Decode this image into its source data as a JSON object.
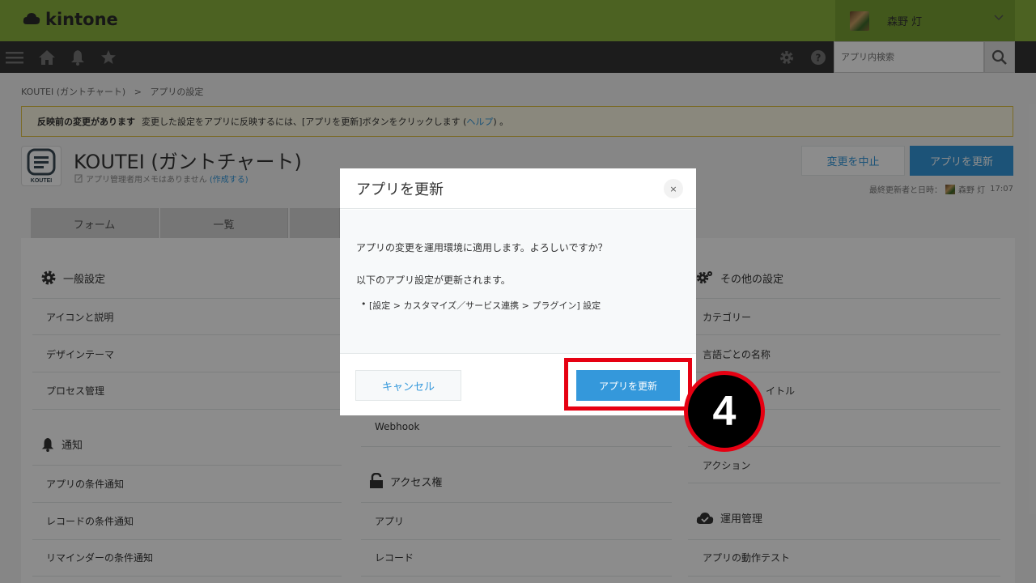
{
  "header": {
    "logo_text": "kintone",
    "user_name": "森野 灯",
    "brand_color": "#8ab33f"
  },
  "navbar": {
    "search_placeholder": "アプリ内検索",
    "icons": [
      "menu-icon",
      "home-icon",
      "bell-icon",
      "star-icon",
      "gear-icon",
      "help-icon",
      "search-icon"
    ]
  },
  "breadcrumb": {
    "app": "KOUTEI (ガントチャート)",
    "separator": ">",
    "current": "アプリの設定"
  },
  "banner": {
    "title": "反映前の変更があります",
    "text": "変更した設定をアプリに反映するには、[アプリを更新]ボタンをクリックします (",
    "link": "ヘルプ",
    "tail": ") 。"
  },
  "app": {
    "icon_label": "KOUTEI",
    "title": "KOUTEI (ガントチャート)",
    "memo": "アプリ管理者用メモはありません",
    "memo_link": "(作成する)",
    "cancel_change_label": "変更を中止",
    "update_label": "アプリを更新",
    "last_updated_label": "最終更新者と日時：",
    "last_updated_user": "森野 灯",
    "last_updated_time": "17:07"
  },
  "tabs": [
    "フォーム",
    "一覧"
  ],
  "settings": {
    "general": {
      "title": "一般設定",
      "items": [
        "アイコンと説明",
        "デザインテーマ",
        "プロセス管理"
      ]
    },
    "notify": {
      "title": "通知",
      "items": [
        "アプリの条件通知",
        "レコードの条件通知",
        "リマインダーの条件通知"
      ]
    },
    "middle": {
      "webhook": "Webhook",
      "access_title": "アクセス権",
      "access_items": [
        "アプリ",
        "レコード"
      ]
    },
    "other": {
      "title": "その他の設定",
      "items": [
        "カテゴリー",
        "言語ごとの名称"
      ],
      "partial_item": "イトル",
      "action": "アクション"
    },
    "ops": {
      "title": "運用管理",
      "items": [
        "アプリの動作テスト"
      ]
    }
  },
  "modal": {
    "title": "アプリを更新",
    "close": "×",
    "message": "アプリの変更を運用環境に適用します。よろしいですか？",
    "sub": "以下のアプリ設定が更新されます。",
    "bullet": "[設定 > カスタマイズ／サービス連携 > プラグイン] 設定",
    "cancel_label": "キャンセル",
    "update_label": "アプリを更新"
  },
  "annotation": {
    "step_number": "4",
    "color": "#e60012"
  }
}
